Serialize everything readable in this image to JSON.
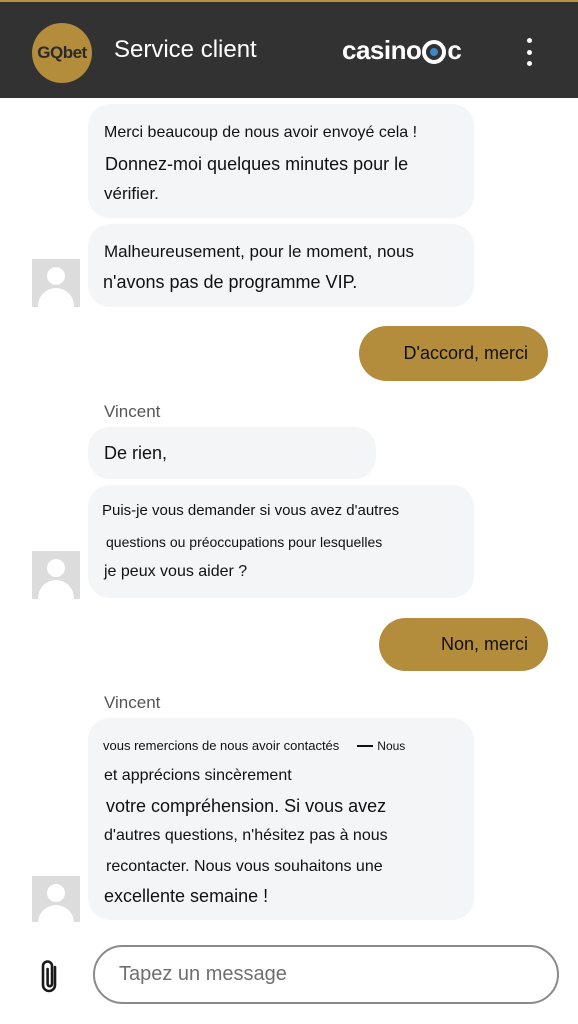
{
  "header": {
    "logo_text": "GQbet",
    "title": "Service client",
    "brand_prefix": "casino",
    "brand_suffix": "c",
    "menu_icon": "kebab-menu-icon"
  },
  "messages": [
    {
      "from": "agent",
      "lines": [
        "Merci beaucoup de nous avoir envoyé cela !",
        "Donnez-moi quelques minutes pour le",
        "vérifier."
      ]
    },
    {
      "from": "agent",
      "lines": [
        "Malheureusement, pour le moment, nous",
        "n'avons pas de programme VIP."
      ]
    },
    {
      "from": "user",
      "text": "D'accord, merci"
    },
    {
      "from": "agent",
      "sender": "Vincent",
      "lines": [
        "De rien,"
      ]
    },
    {
      "from": "agent",
      "lines": [
        "Puis-je vous demander si vous avez d'autres",
        "questions ou préoccupations pour lesquelles",
        "je peux vous aider ?"
      ]
    },
    {
      "from": "user",
      "text": "Non, merci"
    },
    {
      "from": "agent",
      "sender": "Vincent",
      "lines": [
        "vous remercions de nous avoir contactés",
        "Nous",
        "et apprécions sincèrement",
        "votre compréhension. Si vous avez",
        "d'autres questions, n'hésitez pas à nous",
        "recontacter. Nous vous souhaitons une",
        "excellente semaine !"
      ]
    }
  ],
  "composer": {
    "placeholder": "Tapez un message",
    "attach_icon": "paperclip-icon"
  },
  "colors": {
    "header_bg": "#323232",
    "accent_gold": "#b38c3c",
    "agent_bubble": "#f4f5f7"
  }
}
